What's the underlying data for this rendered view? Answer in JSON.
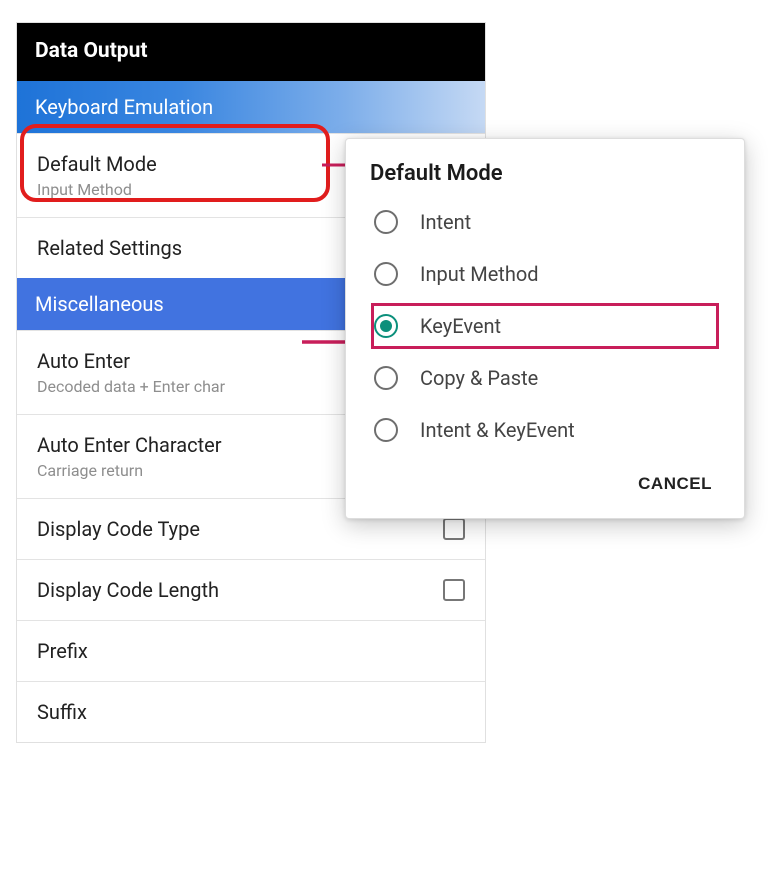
{
  "header": {
    "title": "Data Output"
  },
  "sections": {
    "keyboard": {
      "header": "Keyboard Emulation",
      "default_mode": {
        "title": "Default Mode",
        "subtitle": "Input Method"
      },
      "related": {
        "title": "Related Settings"
      }
    },
    "misc": {
      "header": "Miscellaneous",
      "auto_enter": {
        "title": "Auto Enter",
        "subtitle": "Decoded data + Enter char"
      },
      "auto_enter_char": {
        "title": "Auto Enter Character",
        "subtitle": "Carriage return"
      },
      "display_code_type": {
        "title": "Display Code Type"
      },
      "display_code_length": {
        "title": "Display Code Length"
      },
      "prefix": {
        "title": "Prefix"
      },
      "suffix": {
        "title": "Suffix"
      }
    }
  },
  "dialog": {
    "title": "Default Mode",
    "options": {
      "intent": "Intent",
      "input_method": "Input Method",
      "keyevent": "KeyEvent",
      "copy_paste": "Copy & Paste",
      "intent_keyevent": "Intent & KeyEvent"
    },
    "selected": "keyevent",
    "cancel": "CANCEL"
  }
}
